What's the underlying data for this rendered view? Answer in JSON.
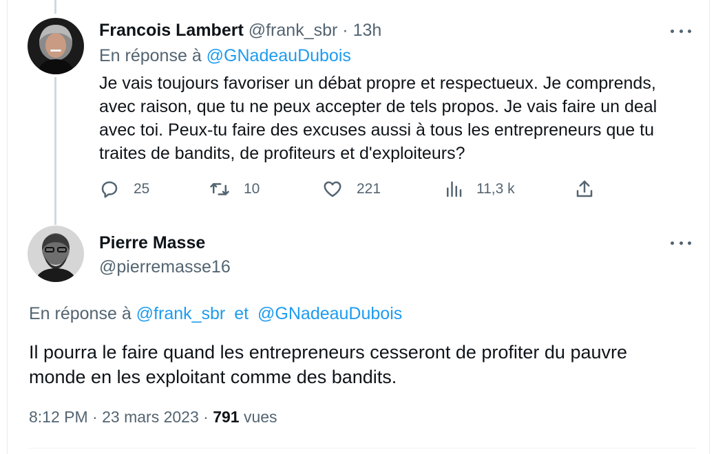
{
  "tweet1": {
    "display_name": "Francois Lambert",
    "handle": "@frank_sbr",
    "separator": "·",
    "time": "13h",
    "reply_prefix": "En réponse à",
    "reply_to": "@GNadeauDubois",
    "text_lines": [
      "Je vais toujours favoriser un débat propre et respectueux. Je comprends,",
      "avec raison, que tu ne peux accepter de tels propos. Je vais faire un deal",
      "avec toi. Peux-tu faire des excuses aussi à tous les entrepreneurs que tu",
      "traites de bandits, de profiteurs et d'exploiteurs?"
    ],
    "actions": {
      "reply_count": "25",
      "retweet_count": "10",
      "like_count": "221",
      "views_count": "11,3 k"
    },
    "icons": [
      "reply-icon",
      "retweet-icon",
      "like-icon",
      "views-icon",
      "share-icon",
      "more-icon"
    ]
  },
  "tweet2": {
    "display_name": "Pierre Masse",
    "handle": "@pierremasse16",
    "reply_prefix": "En réponse à",
    "reply_to_1": "@frank_sbr",
    "reply_and": "et",
    "reply_to_2": "@GNadeauDubois",
    "text_lines": [
      "Il pourra le faire quand les entrepreneurs cesseront de profiter du pauvre",
      "monde en les exploitant comme des bandits."
    ],
    "time": "8:12 PM",
    "separator": "·",
    "date": "23 mars 2023",
    "views_count": "791",
    "views_label": "vues"
  },
  "colors": {
    "text": "#0f1419",
    "muted": "#536471",
    "link": "#1d9bf0",
    "thread_line": "#cfd9de"
  }
}
